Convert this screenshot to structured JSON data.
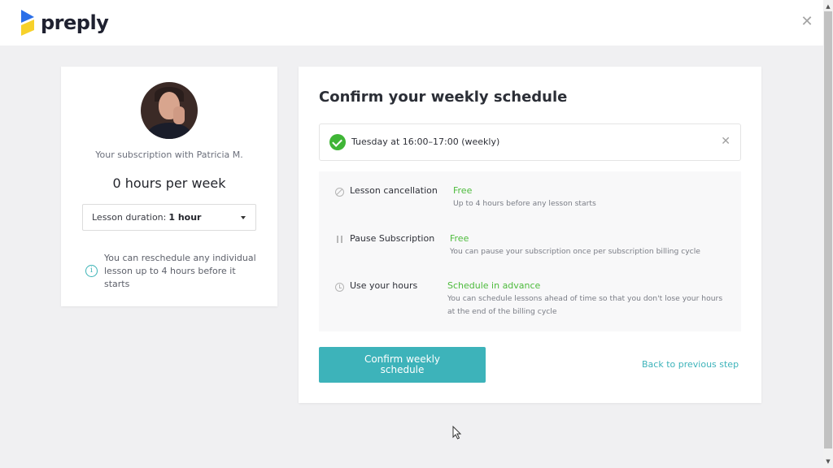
{
  "header": {
    "brand": "preply",
    "close_icon": "close-icon",
    "colors": {
      "logo_blue": "#2b6fe8",
      "logo_yellow": "#f7d12a"
    }
  },
  "subscription_card": {
    "avatar_alt": "Patricia M.",
    "subscription_label": "Your subscription with Patricia M.",
    "hours_per_week": "0 hours per week",
    "duration_select": {
      "label": "Lesson duration:",
      "value": "1 hour"
    },
    "info_text": "You can reschedule any individual lesson up to 4 hours before it starts"
  },
  "schedule_card": {
    "title": "Confirm your weekly schedule",
    "slot": {
      "text": "Tuesday at 16:00–17:00 (weekly)",
      "status_icon": "check-circle-icon",
      "remove_icon": "close-icon"
    },
    "features": [
      {
        "icon": "ban-icon",
        "label": "Lesson cancellation",
        "value": "Free",
        "description": "Up to 4 hours before any lesson starts"
      },
      {
        "icon": "pause-icon",
        "label": "Pause Subscription",
        "value": "Free",
        "description": "You can pause your subscription once per subscription billing cycle"
      },
      {
        "icon": "clock-icon",
        "label": "Use your hours",
        "value": "Schedule in advance",
        "description": "You can schedule lessons ahead of time so that you don't lose your hours at the end of the billing cycle"
      }
    ],
    "confirm_button": "Confirm weekly schedule",
    "back_link": "Back to previous step",
    "colors": {
      "accent": "#3db3ba",
      "success": "#4dbb3c"
    }
  }
}
